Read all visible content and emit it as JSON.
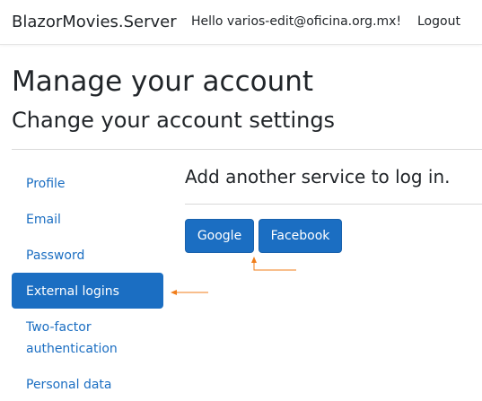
{
  "navbar": {
    "brand": "BlazorMovies.Server",
    "greeting": "Hello varios-edit@oficina.org.mx!",
    "logout": "Logout"
  },
  "page": {
    "title": "Manage your account",
    "subtitle": "Change your account settings"
  },
  "sidebar": {
    "items": [
      {
        "label": "Profile",
        "active": false
      },
      {
        "label": "Email",
        "active": false
      },
      {
        "label": "Password",
        "active": false
      },
      {
        "label": "External logins",
        "active": true
      },
      {
        "label": "Two-factor authentication",
        "active": false
      },
      {
        "label": "Personal data",
        "active": false
      }
    ]
  },
  "main": {
    "heading": "Add another service to log in.",
    "providers": [
      {
        "label": "Google"
      },
      {
        "label": "Facebook"
      }
    ]
  },
  "colors": {
    "primary": "#1b6ec2",
    "annotation": "#f07d1a"
  }
}
